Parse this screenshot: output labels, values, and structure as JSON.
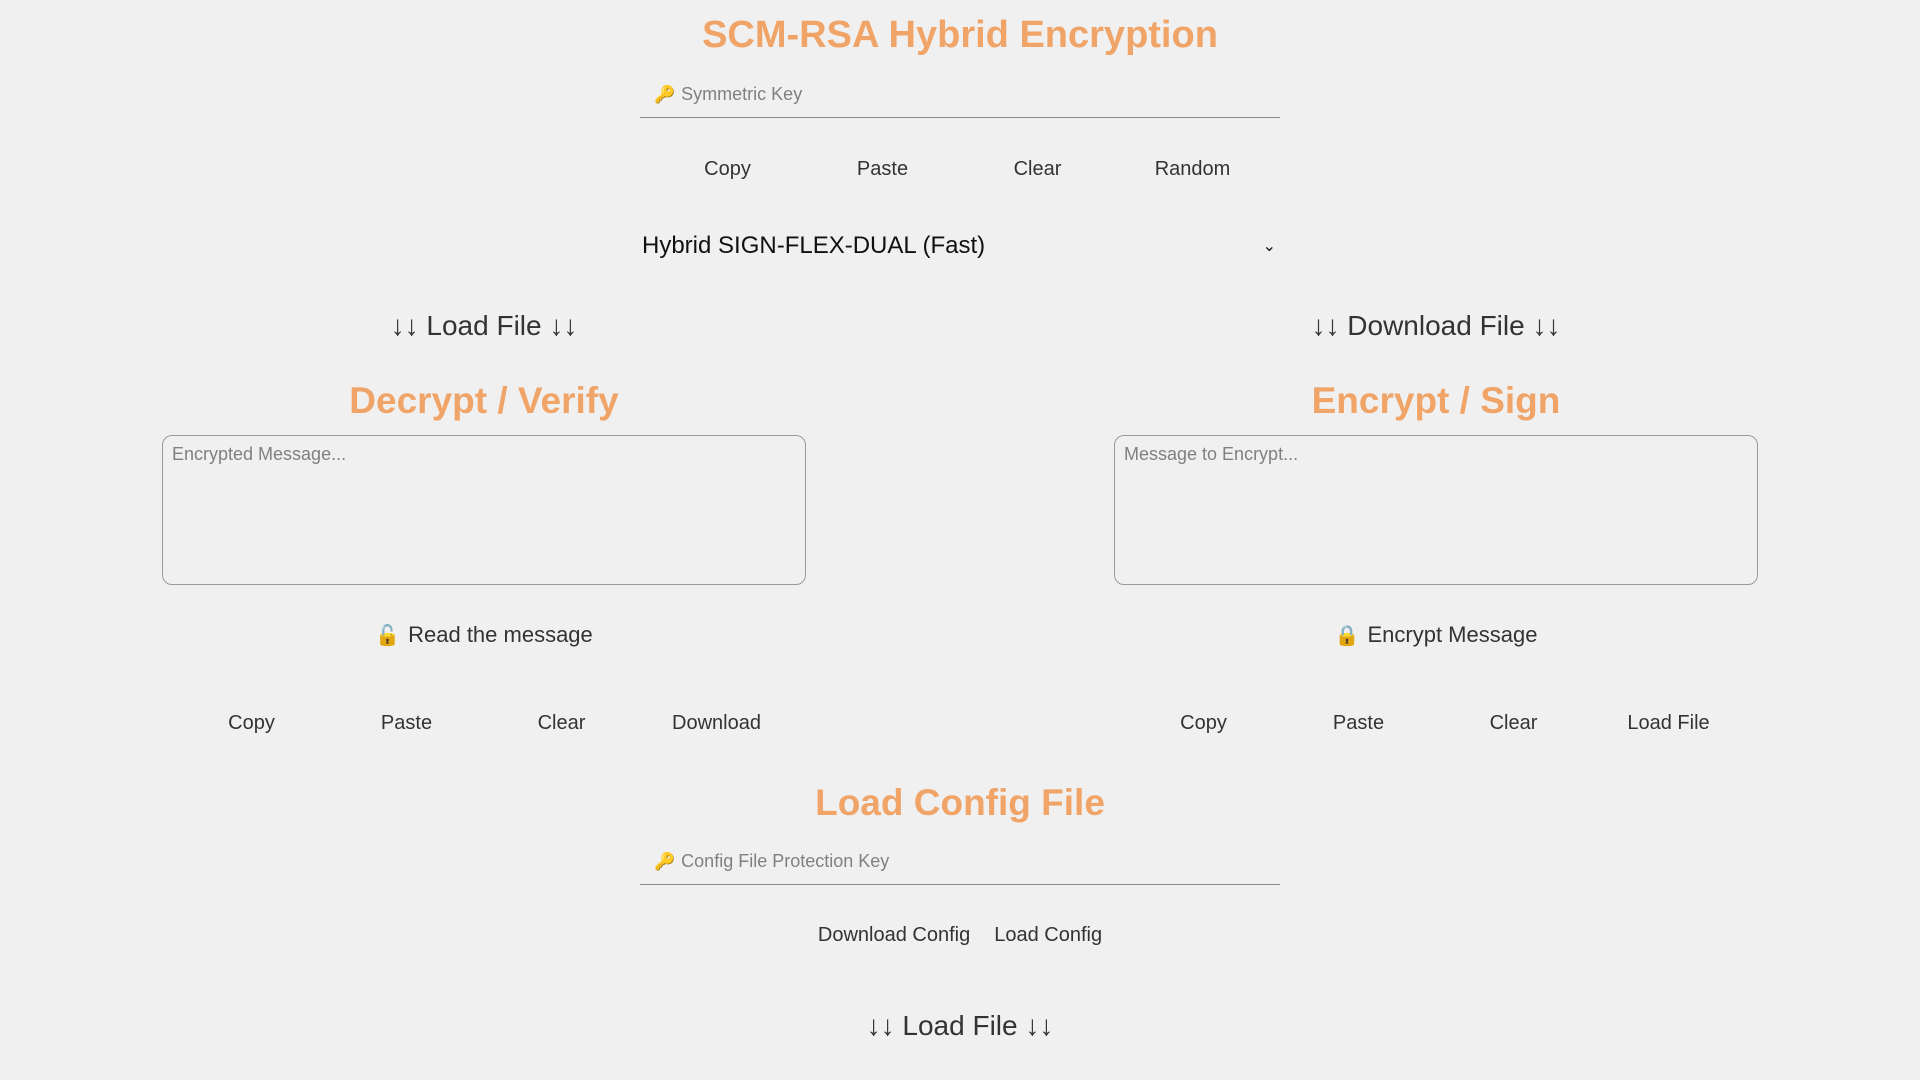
{
  "header": {
    "title": "SCM-RSA Hybrid Encryption"
  },
  "symmetric_key": {
    "icon": "key-icon",
    "placeholder": "Symmetric Key",
    "value": ""
  },
  "key_buttons": {
    "copy": "Copy",
    "paste": "Paste",
    "clear": "Clear",
    "random": "Random"
  },
  "mode_select": {
    "selected": "Hybrid SIGN-FLEX-DUAL (Fast)",
    "chevron": "⌄"
  },
  "file_links": {
    "load_file": "↓↓ Load File ↓↓",
    "download_file": "↓↓ Download File ↓↓"
  },
  "decrypt_panel": {
    "title": "Decrypt / Verify",
    "placeholder": "Encrypted Message...",
    "value": "",
    "action_icon": "🔓",
    "action_label": "Read the message",
    "buttons": {
      "copy": "Copy",
      "paste": "Paste",
      "clear": "Clear",
      "download": "Download"
    }
  },
  "encrypt_panel": {
    "title": "Encrypt / Sign",
    "placeholder": "Message to Encrypt...",
    "value": "",
    "action_icon": "🔒",
    "action_label": "Encrypt Message",
    "buttons": {
      "copy": "Copy",
      "paste": "Paste",
      "clear": "Clear",
      "load_file": "Load File"
    }
  },
  "config": {
    "title": "Load Config File",
    "key_placeholder": "Config File Protection Key",
    "key_value": "",
    "download_config": "Download Config",
    "load_config": "Load Config",
    "load_file": "↓↓ Load File ↓↓"
  },
  "colors": {
    "accent": "#f0a467",
    "background": "#f0f0f0",
    "text": "#333333"
  }
}
